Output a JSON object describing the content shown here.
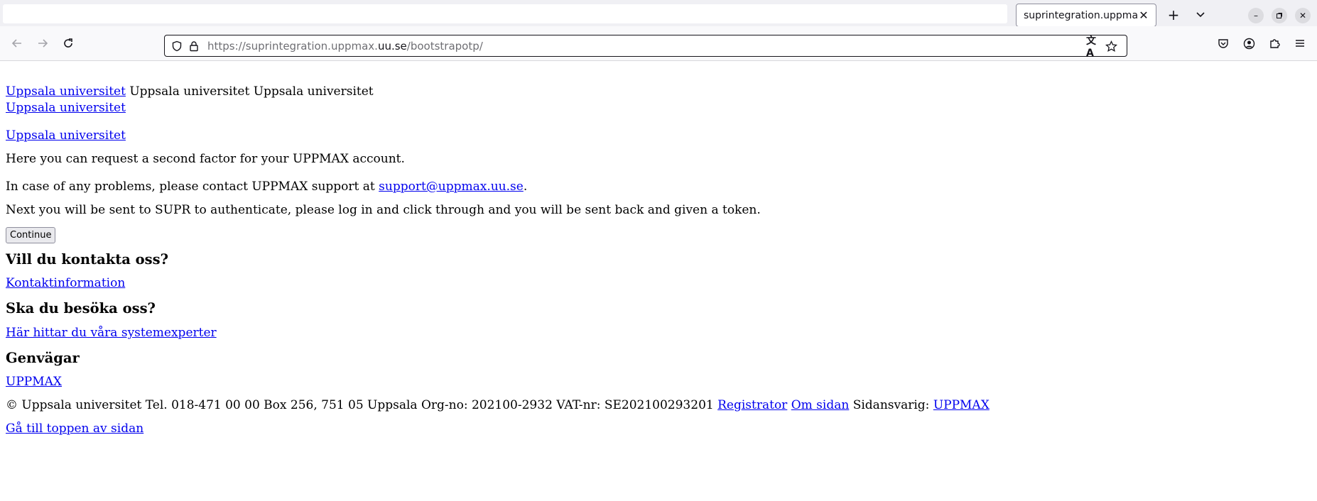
{
  "browser": {
    "tab_title": "suprintegration.uppmax",
    "url_prefix": "https://suprintegration.uppmax.",
    "url_domain": "uu.se",
    "url_path": "/bootstrapotp/"
  },
  "header": {
    "logo_link": "Uppsala universitet",
    "logo_text_1": "Uppsala universitet",
    "logo_text_2": "Uppsala universitet",
    "link_2": "Uppsala universitet",
    "link_3": "Uppsala universitet"
  },
  "main": {
    "intro": "Here you can request a second factor for your UPPMAX account.",
    "contact_prefix": "In case of any problems, please contact UPPMAX support at ",
    "contact_email": "support@uppmax.uu.se",
    "contact_suffix": ".",
    "next_info": "Next you will be sent to SUPR to authenticate, please log in and click through and you will be sent back and given a token.",
    "continue_label": "Continue"
  },
  "footer": {
    "contact_heading": "Vill du kontakta oss?",
    "contact_link": "Kontaktinformation",
    "visit_heading": "Ska du besöka oss?",
    "visit_link": "Här hittar du våra systemexperter",
    "shortcuts_heading": "Genvägar",
    "shortcuts_link": "UPPMAX",
    "copyright": "© Uppsala universitet Tel. 018-471 00 00 Box 256, 751 05 Uppsala Org-no: 202100-2932 VAT-nr: SE202100293201",
    "registrator_link": "Registrator",
    "about_link": "Om sidan",
    "responsible_label": "Sidansvarig:",
    "responsible_link": "UPPMAX",
    "top_link": "Gå till toppen av sidan"
  }
}
